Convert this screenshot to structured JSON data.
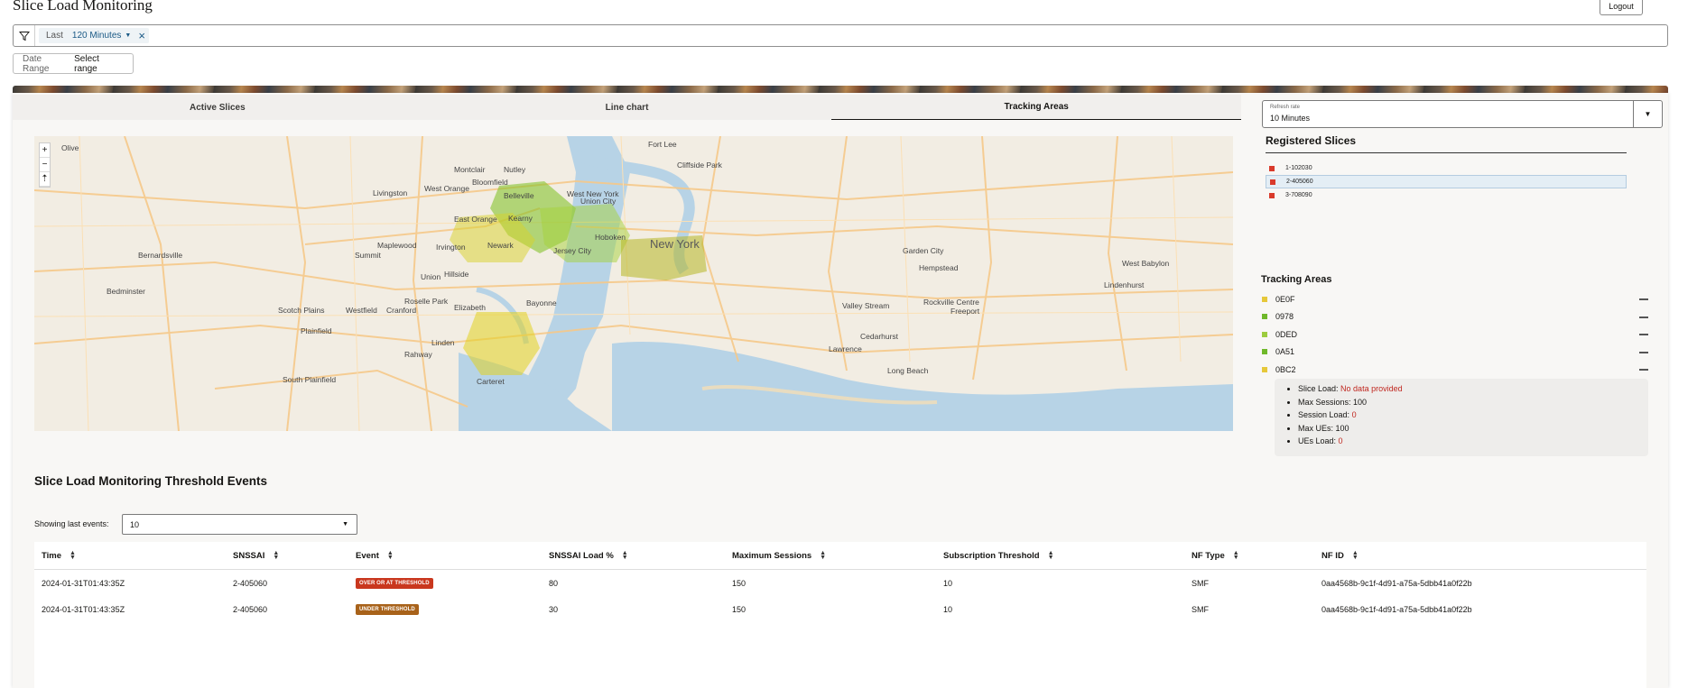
{
  "app": {
    "title": "Slice Load Monitoring",
    "logout_label": "Logout"
  },
  "filter": {
    "chip_label": "Last",
    "chip_value": "120 Minutes"
  },
  "date_range": {
    "label": "Date Range",
    "value": "Select range"
  },
  "tabs": [
    {
      "label": "Active Slices",
      "active": false
    },
    {
      "label": "Line chart",
      "active": false
    },
    {
      "label": "Tracking Areas",
      "active": true
    }
  ],
  "refresh": {
    "label": "Refresh rate",
    "value": "10 Minutes"
  },
  "registered_slices": {
    "title": "Registered Slices",
    "items": [
      {
        "label": "1-102030",
        "color": "#d93a2b",
        "selected": false
      },
      {
        "label": "2-405060",
        "color": "#d93a2b",
        "selected": true
      },
      {
        "label": "3-708090",
        "color": "#d93a2b",
        "selected": false
      }
    ]
  },
  "tracking_areas": {
    "title": "Tracking Areas",
    "items": [
      {
        "label": "0E0F",
        "color": "#e6c83a"
      },
      {
        "label": "0978",
        "color": "#6fb82a"
      },
      {
        "label": "0DED",
        "color": "#9ccc3e"
      },
      {
        "label": "0A51",
        "color": "#6fb82a"
      },
      {
        "label": "0BC2",
        "color": "#e6c83a"
      }
    ]
  },
  "info": {
    "slice_load_label": "Slice Load:",
    "slice_load_value": "No data provided",
    "max_sessions_label": "Max Sessions:",
    "max_sessions_value": "100",
    "session_load_label": "Session Load:",
    "session_load_value": "0",
    "max_ues_label": "Max UEs:",
    "max_ues_value": "100",
    "ues_load_label": "UEs Load:",
    "ues_load_value": "0"
  },
  "map": {
    "places": [
      "Olive",
      "Montclair",
      "Nutley",
      "Belleville",
      "Kearny",
      "East Orange",
      "West Orange",
      "Livingston",
      "Bernardsville",
      "Bedminster",
      "Summit",
      "Maplewood",
      "Irvington",
      "Newark",
      "Union",
      "Hillside",
      "Elizabeth",
      "Roselle Park",
      "Cranford",
      "Westfield",
      "Scotch Plains",
      "Plainfield",
      "Linden",
      "Rahway",
      "Bayonne",
      "Jersey City",
      "Hoboken",
      "Union City",
      "West New York",
      "Fort Lee",
      "Cliffside Park",
      "New York",
      "Garden City",
      "Hempstead",
      "Valley Stream",
      "Rockville Centre",
      "Freeport",
      "Cedarhurst",
      "Lawrence",
      "Long Beach",
      "West Babylon",
      "Lindenhurst",
      "South Plainfield",
      "Bloomfield",
      "Carteret"
    ],
    "zoom_in": "+",
    "zoom_out": "−",
    "reset": "⇡"
  },
  "events": {
    "title": "Slice Load Monitoring Threshold Events",
    "showing_label": "Showing last events:",
    "showing_value": "10",
    "columns": [
      "Time",
      "SNSSAI",
      "Event",
      "SNSSAI Load %",
      "Maximum Sessions",
      "Subscription Threshold",
      "NF Type",
      "NF ID"
    ],
    "rows": [
      {
        "time": "2024-01-31T01:43:35Z",
        "snssai": "2-405060",
        "event": "OVER OR AT THRESHOLD",
        "event_color": "#c9371e",
        "load": "80",
        "max_sessions": "150",
        "threshold": "10",
        "nf_type": "SMF",
        "nf_id": "0aa4568b-9c1f-4d91-a75a-5dbb41a0f22b"
      },
      {
        "time": "2024-01-31T01:43:35Z",
        "snssai": "2-405060",
        "event": "UNDER THRESHOLD",
        "event_color": "#a8621a",
        "load": "30",
        "max_sessions": "150",
        "threshold": "10",
        "nf_type": "SMF",
        "nf_id": "0aa4568b-9c1f-4d91-a75a-5dbb41a0f22b"
      }
    ]
  }
}
